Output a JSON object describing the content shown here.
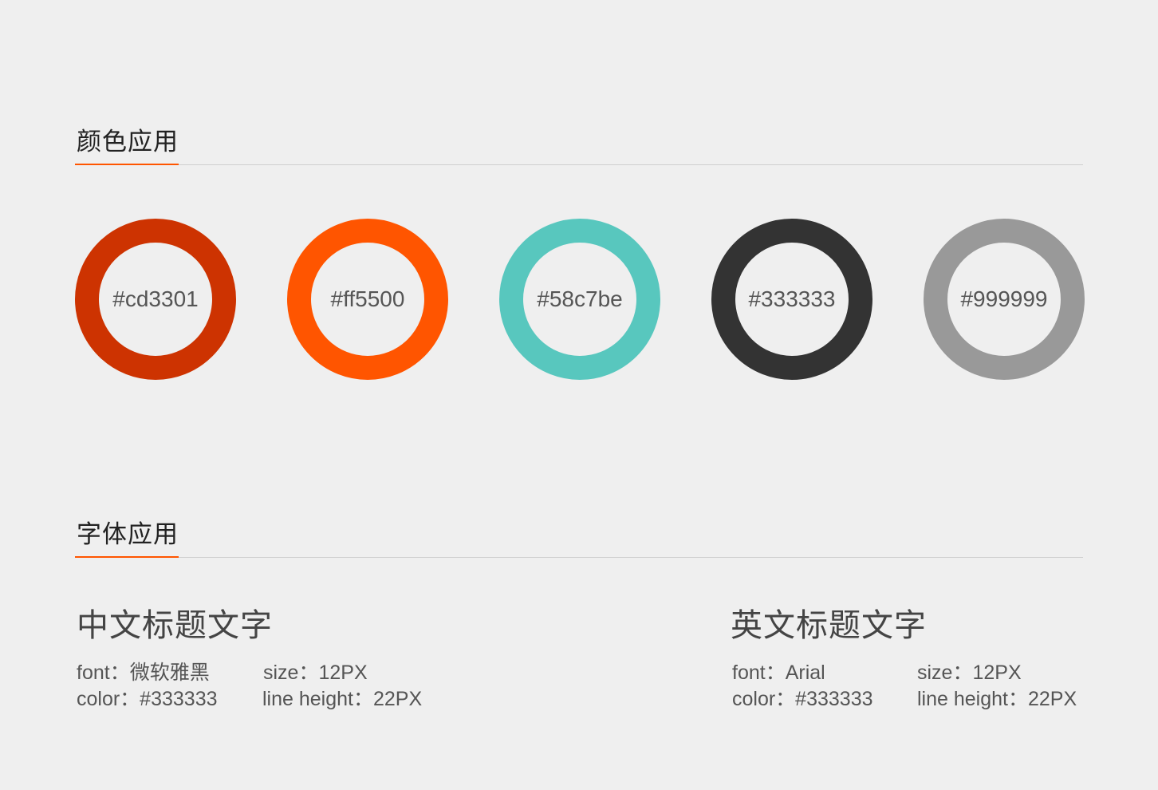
{
  "color_section": {
    "title": "颜色应用",
    "accent_color": "#ff5500",
    "swatches": [
      {
        "label": "#cd3301",
        "color": "#cd3301"
      },
      {
        "label": "#ff5500",
        "color": "#ff5500"
      },
      {
        "label": "#58c7be",
        "color": "#58c7be"
      },
      {
        "label": "#333333",
        "color": "#333333"
      },
      {
        "label": "#999999",
        "color": "#999999"
      }
    ]
  },
  "font_section": {
    "title": "字体应用",
    "chinese": {
      "heading": "中文标题文字",
      "font": "font：微软雅黑",
      "size": "size：12PX",
      "color": "color：#333333",
      "line_height": "line height：22PX"
    },
    "english": {
      "heading": "英文标题文字",
      "font": "font：Arial",
      "size": "size：12PX",
      "color": "color：#333333",
      "line_height": "line height：22PX"
    }
  }
}
